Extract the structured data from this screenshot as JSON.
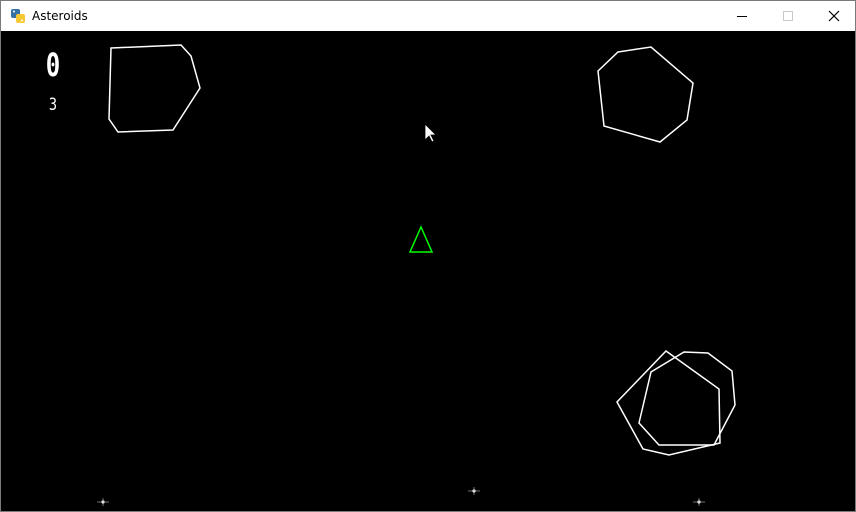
{
  "window": {
    "title": "Asteroids",
    "controls": {
      "minimize": "minimize",
      "maximize": "maximize",
      "close": "close"
    }
  },
  "hud": {
    "score": "0",
    "lives": "3"
  },
  "colors": {
    "background": "#000000",
    "asteroid": "#ffffff",
    "ship": "#00ff00"
  }
}
